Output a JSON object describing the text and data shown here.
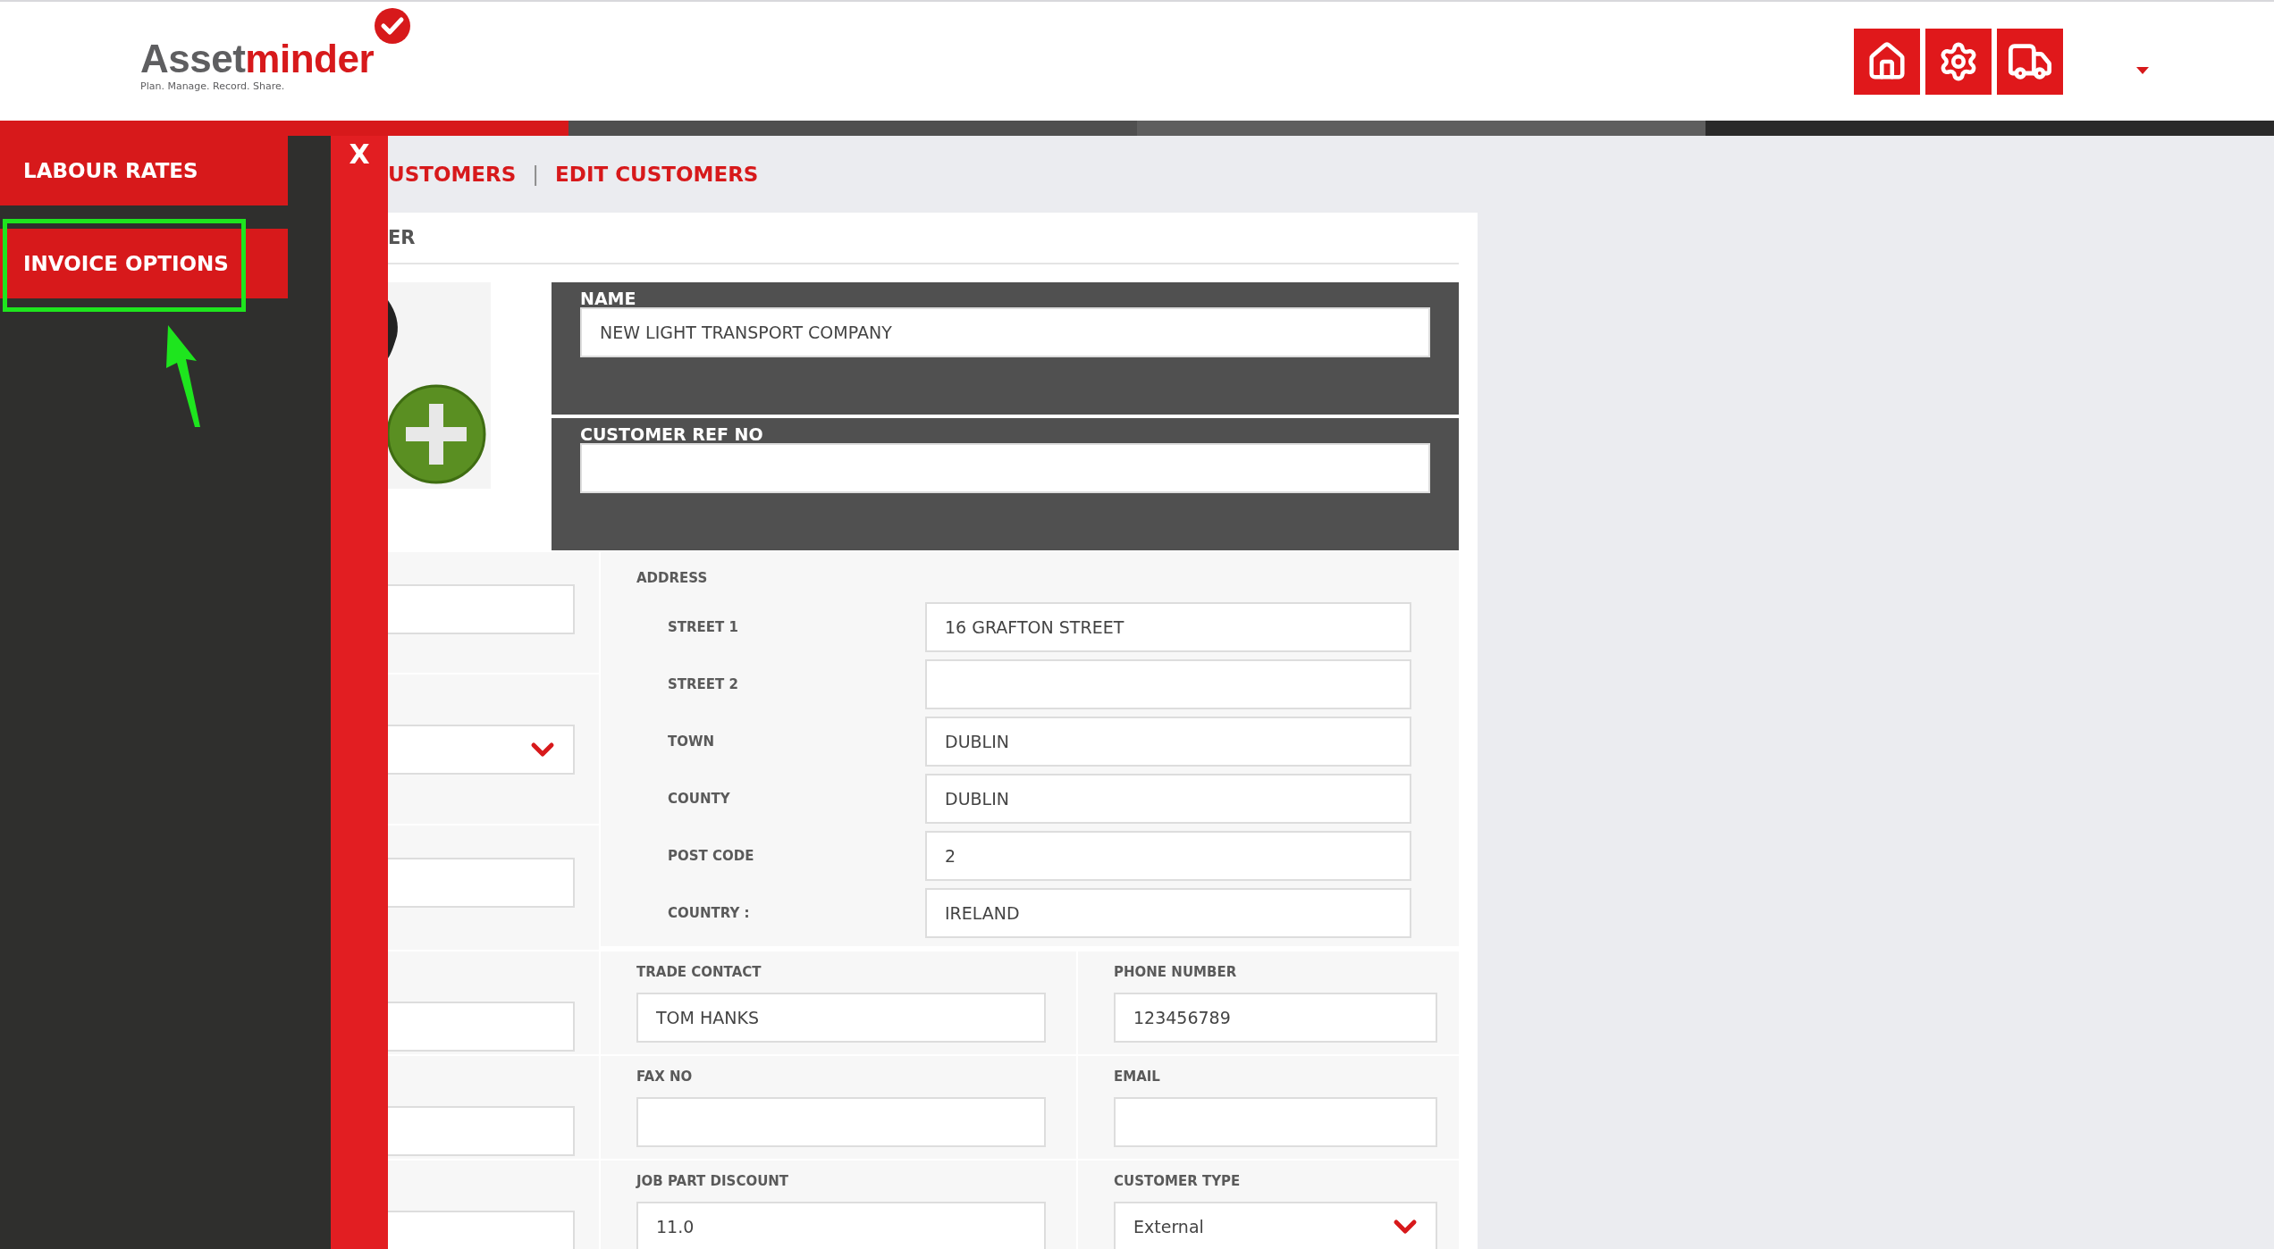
{
  "header": {
    "logo": {
      "wordmark_dark": "Asset",
      "wordmark_red": "minder",
      "tagline": "Plan. Manage. Record. Share."
    },
    "toolbar": [
      {
        "kind": "home"
      },
      {
        "kind": "settings"
      },
      {
        "kind": "truck"
      }
    ]
  },
  "sidebar": {
    "items": [
      {
        "label": "LABOUR RATES",
        "highlighted": false
      },
      {
        "label": "INVOICE OPTIONS",
        "highlighted": true
      }
    ],
    "close": "X"
  },
  "breadcrumb": {
    "items": [
      "USTOMERS",
      "EDIT CUSTOMERS"
    ],
    "separator": "|"
  },
  "card": {
    "title": "ER",
    "name": {
      "label": "NAME",
      "value": "NEW LIGHT TRANSPORT COMPANY"
    },
    "ref": {
      "label": "CUSTOMER REF NO"
    },
    "left_fields": [
      {
        "kind": "input"
      },
      {
        "kind": "select"
      },
      {
        "kind": "input"
      },
      {
        "kind": "input"
      },
      {
        "kind": "input"
      },
      {
        "kind": "input"
      }
    ],
    "address": {
      "label": "ADDRESS",
      "rows": [
        {
          "label": "STREET 1",
          "value": "16 GRAFTON STREET"
        },
        {
          "label": "STREET 2"
        },
        {
          "label": "TOWN",
          "value": "DUBLIN"
        },
        {
          "label": "COUNTY",
          "value": "DUBLIN"
        },
        {
          "label": "POST CODE",
          "value": "2"
        },
        {
          "label": "COUNTRY :",
          "value": "IRELAND"
        }
      ]
    },
    "rows": [
      [
        {
          "label": "TRADE CONTACT",
          "kind": "input",
          "value": "TOM HANKS"
        },
        {
          "label": "PHONE NUMBER",
          "kind": "input",
          "value": "123456789"
        }
      ],
      [
        {
          "label": "FAX NO",
          "kind": "input"
        },
        {
          "label": "EMAIL",
          "kind": "input"
        }
      ],
      [
        {
          "label": "JOB PART DISCOUNT",
          "kind": "input",
          "value": "11.0"
        },
        {
          "label": "CUSTOMER TYPE",
          "kind": "select",
          "value": "External"
        }
      ]
    ]
  }
}
